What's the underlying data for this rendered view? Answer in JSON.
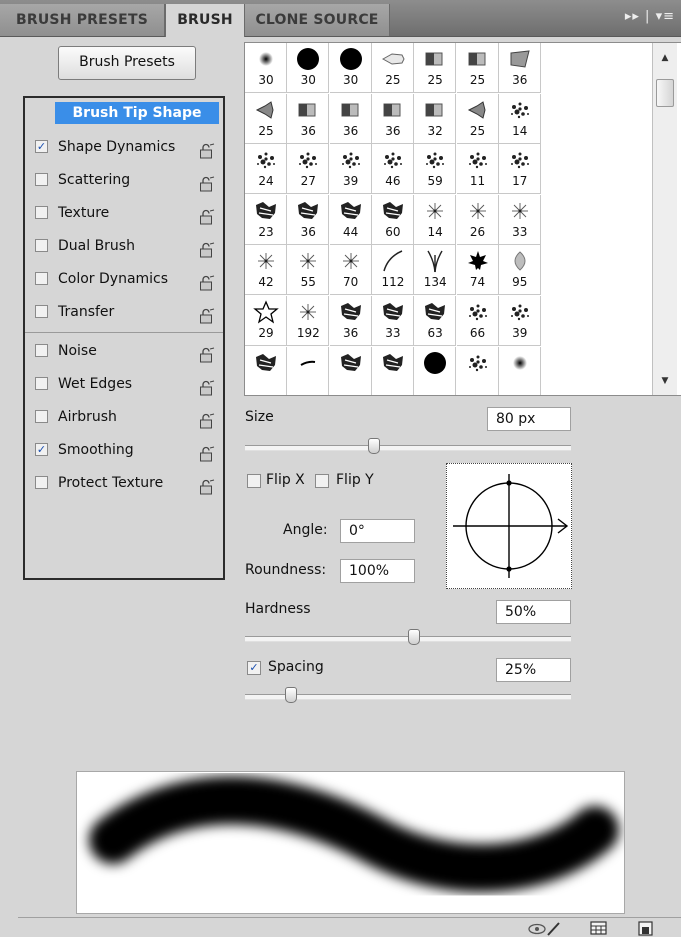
{
  "tabs": [
    {
      "label": "BRUSH PRESETS",
      "active": false
    },
    {
      "label": "BRUSH",
      "active": true
    },
    {
      "label": "CLONE SOURCE",
      "active": false
    }
  ],
  "panel_menu_icons": "▸▸ | ▾≡",
  "brush_presets_button": "Brush Presets",
  "options": {
    "header": "Brush Tip Shape",
    "items": [
      {
        "label": "Shape Dynamics",
        "checked": true
      },
      {
        "label": "Scattering",
        "checked": false
      },
      {
        "label": "Texture",
        "checked": false
      },
      {
        "label": "Dual Brush",
        "checked": false
      },
      {
        "label": "Color Dynamics",
        "checked": false
      },
      {
        "label": "Transfer",
        "checked": false
      },
      {
        "label": "Noise",
        "checked": false
      },
      {
        "label": "Wet Edges",
        "checked": false
      },
      {
        "label": "Airbrush",
        "checked": false
      },
      {
        "label": "Smoothing",
        "checked": true
      },
      {
        "label": "Protect Texture",
        "checked": false
      }
    ]
  },
  "brush_tips": [
    {
      "size": "30",
      "icon": "soft-round"
    },
    {
      "size": "30",
      "icon": "hard-round"
    },
    {
      "size": "30",
      "icon": "hard-round"
    },
    {
      "size": "25",
      "icon": "chalk"
    },
    {
      "size": "25",
      "icon": "flat-bristle"
    },
    {
      "size": "25",
      "icon": "flat-bristle"
    },
    {
      "size": "36",
      "icon": "fan-bristle"
    },
    {
      "size": "25",
      "icon": "round-bristle"
    },
    {
      "size": "36",
      "icon": "flat-bristle"
    },
    {
      "size": "36",
      "icon": "flat-bristle"
    },
    {
      "size": "36",
      "icon": "flat-bristle"
    },
    {
      "size": "32",
      "icon": "flat-bristle"
    },
    {
      "size": "25",
      "icon": "round-bristle"
    },
    {
      "size": "14",
      "icon": "spatter"
    },
    {
      "size": "24",
      "icon": "spatter"
    },
    {
      "size": "27",
      "icon": "spatter"
    },
    {
      "size": "39",
      "icon": "spatter"
    },
    {
      "size": "46",
      "icon": "spatter"
    },
    {
      "size": "59",
      "icon": "spatter"
    },
    {
      "size": "11",
      "icon": "spatter"
    },
    {
      "size": "17",
      "icon": "spatter"
    },
    {
      "size": "23",
      "icon": "chalk-texture"
    },
    {
      "size": "36",
      "icon": "chalk-texture"
    },
    {
      "size": "44",
      "icon": "chalk-texture"
    },
    {
      "size": "60",
      "icon": "chalk-texture"
    },
    {
      "size": "14",
      "icon": "star-burst"
    },
    {
      "size": "26",
      "icon": "star-burst"
    },
    {
      "size": "33",
      "icon": "star-burst"
    },
    {
      "size": "42",
      "icon": "star-burst"
    },
    {
      "size": "55",
      "icon": "star-burst"
    },
    {
      "size": "70",
      "icon": "star-burst"
    },
    {
      "size": "112",
      "icon": "dune-grass"
    },
    {
      "size": "134",
      "icon": "grass"
    },
    {
      "size": "74",
      "icon": "maple-leaf"
    },
    {
      "size": "95",
      "icon": "leaf"
    },
    {
      "size": "29",
      "icon": "star-outline"
    },
    {
      "size": "192",
      "icon": "star-burst"
    },
    {
      "size": "36",
      "icon": "chalk-texture"
    },
    {
      "size": "33",
      "icon": "chalk-texture"
    },
    {
      "size": "63",
      "icon": "chalk-texture"
    },
    {
      "size": "66",
      "icon": "spatter"
    },
    {
      "size": "39",
      "icon": "spatter"
    },
    {
      "size": "",
      "icon": "chalk-texture"
    },
    {
      "size": "",
      "icon": "stroke-dash"
    },
    {
      "size": "",
      "icon": "chalk-texture"
    },
    {
      "size": "",
      "icon": "chalk-texture"
    },
    {
      "size": "",
      "icon": "hard-round"
    },
    {
      "size": "",
      "icon": "spatter"
    },
    {
      "size": "",
      "icon": "soft-round"
    }
  ],
  "controls": {
    "size_label": "Size",
    "size_value": "80 px",
    "size_slider": 0.5,
    "flip_x_label": "Flip X",
    "flip_y_label": "Flip Y",
    "flip_x_checked": false,
    "flip_y_checked": false,
    "angle_label": "Angle:",
    "angle_value": "0°",
    "roundness_label": "Roundness:",
    "roundness_value": "100%",
    "hardness_label": "Hardness",
    "hardness_value": "50%",
    "hardness_slider": 0.5,
    "spacing_label": "Spacing",
    "spacing_value": "25%",
    "spacing_checked": true,
    "spacing_slider": 0.25
  },
  "bottom_icons": [
    "eye-brush-icon",
    "grid-icon",
    "new-preset-icon"
  ],
  "accent_color": "#3a8ee8"
}
